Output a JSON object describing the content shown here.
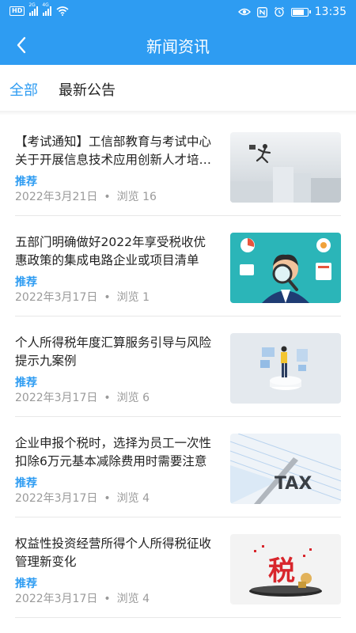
{
  "status_bar": {
    "hd_badge": "HD",
    "sig1_label": "2G",
    "sig2_label": "4G",
    "time": "13:35"
  },
  "nav": {
    "title": "新闻资讯"
  },
  "tabs": [
    {
      "label": "全部",
      "active": true
    },
    {
      "label": "最新公告",
      "active": false
    }
  ],
  "news": [
    {
      "title": "【考试通知】工信部教育与考试中心关于开展信息技术应用创新人才培养的通知",
      "tag": "推荐",
      "date": "2022年3月21日",
      "dot": "•",
      "views": "浏览 16"
    },
    {
      "title": "五部门明确做好2022年享受税收优惠政策的集成电路企业或项目清单",
      "tag": "推荐",
      "date": "2022年3月17日",
      "dot": "•",
      "views": "浏览 1"
    },
    {
      "title": "个人所得税年度汇算服务引导与风险提示九案例",
      "tag": "推荐",
      "date": "2022年3月17日",
      "dot": "•",
      "views": "浏览 6"
    },
    {
      "title": "企业申报个税时，选择为员工一次性扣除6万元基本减除费用时需要注意",
      "tag": "推荐",
      "date": "2022年3月17日",
      "dot": "•",
      "views": "浏览 4"
    },
    {
      "title": "权益性投资经营所得个人所得税征收管理新变化",
      "tag": "推荐",
      "date": "2022年3月17日",
      "dot": "•",
      "views": "浏览 4"
    }
  ],
  "thumb_texts": {
    "tax_label": "TAX",
    "tax_char": "税"
  },
  "colors": {
    "primary": "#2e9cf2",
    "meta": "#9a9a9a",
    "divider": "#e8e8e8"
  }
}
